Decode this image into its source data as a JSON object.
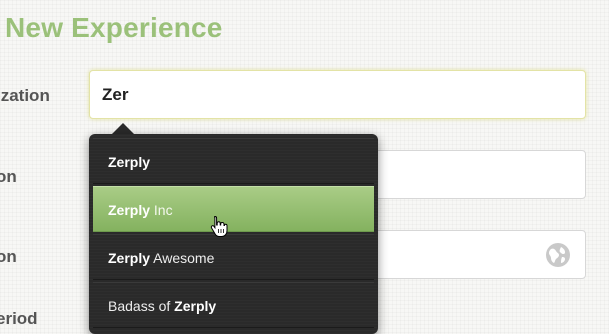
{
  "page": {
    "title": "New Experience"
  },
  "form": {
    "organization": {
      "label": "ization",
      "value": "Zer"
    },
    "position": {
      "label": "on",
      "value": ""
    },
    "location": {
      "label": "on",
      "value": ""
    },
    "period": {
      "label": "eriod"
    }
  },
  "autocomplete": {
    "items": [
      {
        "match": "Zerply",
        "rest": "",
        "prefix": ""
      },
      {
        "match": "Zerply",
        "rest": " Inc",
        "prefix": ""
      },
      {
        "match": "Zerply",
        "rest": " Awesome",
        "prefix": ""
      },
      {
        "match": "Zerply",
        "rest": "",
        "prefix": "Badass of "
      }
    ],
    "highlighted_index": 1
  },
  "icons": {
    "location_field": "globe-icon",
    "pointer": "hand-cursor-icon"
  },
  "colors": {
    "accent": "#9bc17a",
    "highlight": "#96c06f",
    "dropdown_bg": "#2a2a2a"
  }
}
